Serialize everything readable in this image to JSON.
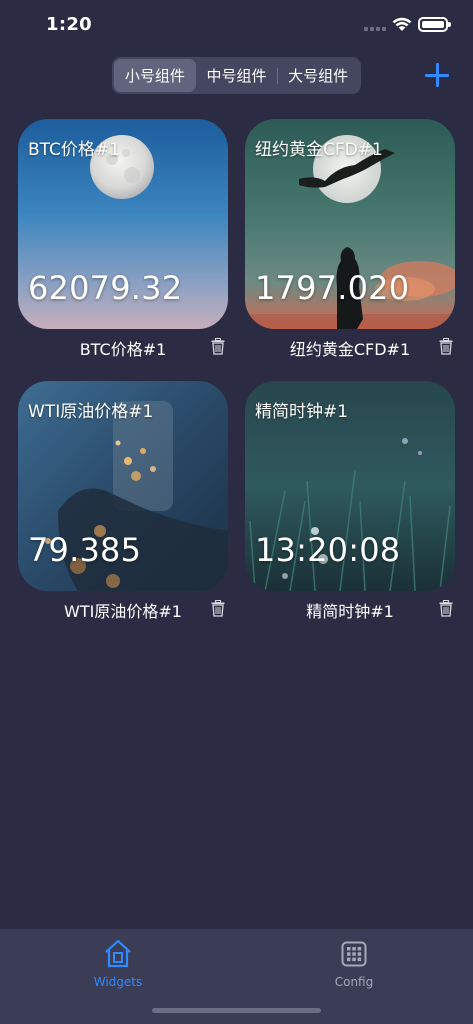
{
  "status_bar": {
    "time": "1:20"
  },
  "segmented": {
    "options": [
      "小号组件",
      "中号组件",
      "大号组件"
    ],
    "selected": "小号组件"
  },
  "widgets": [
    {
      "title": "BTC价格#1",
      "value": "62079.32",
      "caption": "BTC价格#1",
      "background": "moon-blue-sky"
    },
    {
      "title": "纽约黄金CFD#1",
      "value": "1797.020",
      "caption": "纽约黄金CFD#1",
      "background": "moon-sleigh-silhouette"
    },
    {
      "title": "WTI原油价格#1",
      "value": "79.385",
      "caption": "WTI原油价格#1",
      "background": "glass-bokeh-hand"
    },
    {
      "title": "精简时钟#1",
      "value": "13:20:08",
      "caption": "精简时钟#1",
      "background": "grass-night-flowers"
    }
  ],
  "tab_bar": {
    "items": [
      {
        "label": "Widgets",
        "icon": "house-icon",
        "active": true
      },
      {
        "label": "Config",
        "icon": "grid-icon",
        "active": false
      }
    ]
  },
  "colors": {
    "background": "#2b2c43",
    "accent": "#2f8bff",
    "tab_bar": "#3b3c56",
    "inactive_tab": "#a7a8b8"
  }
}
